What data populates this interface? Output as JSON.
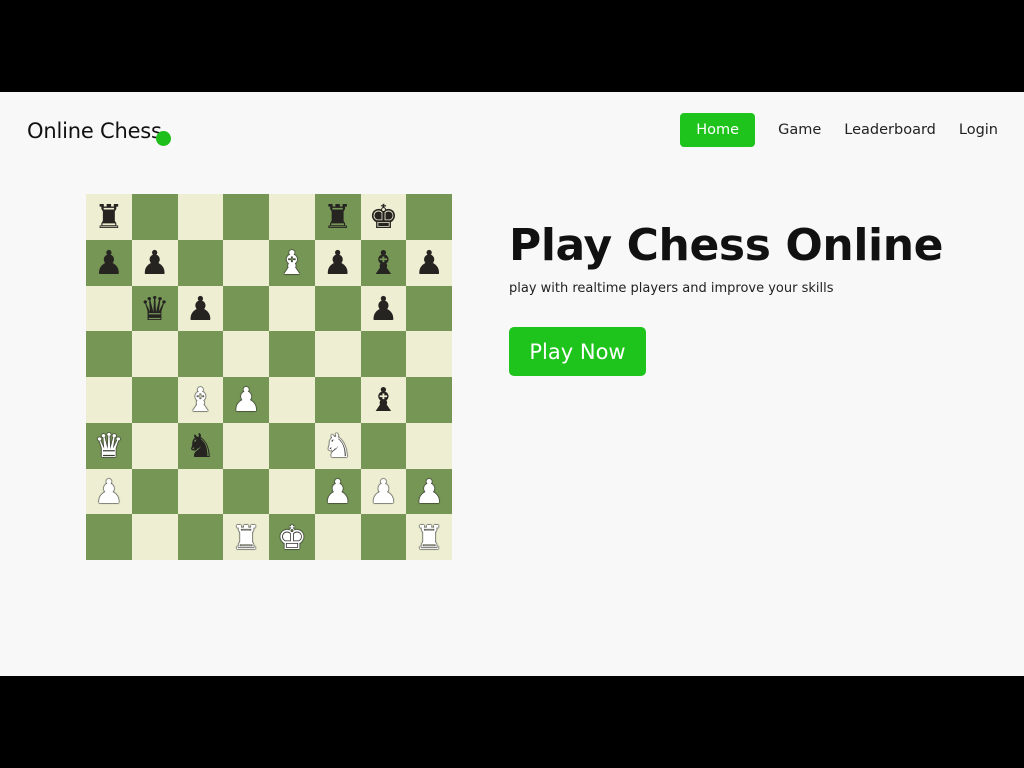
{
  "brand": "Online Chess",
  "nav": {
    "items": [
      {
        "label": "Home",
        "active": true
      },
      {
        "label": "Game",
        "active": false
      },
      {
        "label": "Leaderboard",
        "active": false
      },
      {
        "label": "Login",
        "active": false
      }
    ]
  },
  "hero": {
    "title": "Play Chess Online",
    "subtitle": "play with realtime players and improve your skills",
    "cta": "Play Now"
  },
  "board": {
    "rows": [
      [
        "br",
        "",
        "",
        "",
        "",
        "br",
        "bk",
        ""
      ],
      [
        "bp",
        "bp",
        "",
        "",
        "wb",
        "bp",
        "bb",
        "bp"
      ],
      [
        "",
        "bq",
        "bp",
        "",
        "",
        "",
        "bp",
        ""
      ],
      [
        "",
        "",
        "",
        "",
        "",
        "",
        "",
        ""
      ],
      [
        "",
        "",
        "wb",
        "wp",
        "",
        "",
        "bb",
        ""
      ],
      [
        "wq",
        "",
        "bn",
        "",
        "",
        "wn",
        "",
        ""
      ],
      [
        "wp",
        "",
        "",
        "",
        "",
        "wp",
        "wp",
        "wp"
      ],
      [
        "",
        "",
        "",
        "wr",
        "wk",
        "",
        "",
        "wr"
      ]
    ]
  },
  "colors": {
    "accent": "#1ec41c",
    "light_square": "#edeed2",
    "dark_square": "#769656",
    "page_bg": "#f8f8f8"
  }
}
